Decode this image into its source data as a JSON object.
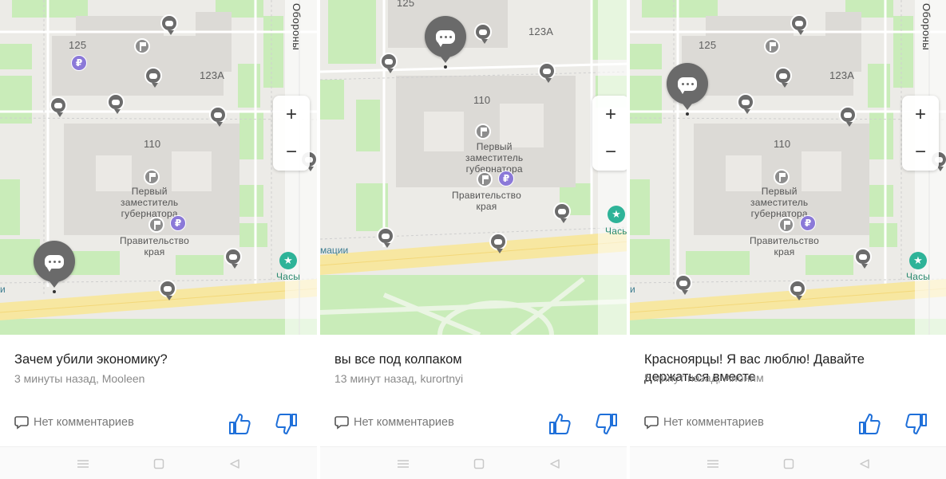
{
  "screens": [
    {
      "map": {
        "labels": {
          "house_125": "125",
          "house_123a": "123А",
          "house_110": "110",
          "street": "Обороны",
          "cut_label": "и"
        },
        "poi_deputy": "Первый\nзаместитель\nгубернатора",
        "poi_government": "Правительство\nкрая",
        "poi_clock": "Часы"
      },
      "post": {
        "title": "Зачем убили экономику?",
        "meta": "3 минуты назад, Mooleen"
      },
      "comments_label": "Нет комментариев"
    },
    {
      "map": {
        "labels": {
          "house_125": "125",
          "house_123a": "123А",
          "house_110": "110",
          "street": "",
          "cut_label": "мации"
        },
        "poi_deputy": "Первый\nзаместитель\nгубернатора",
        "poi_government": "Правительство\nкрая",
        "poi_clock": "Часы"
      },
      "post": {
        "title": "вы все под колпаком",
        "meta": "13 минут назад, kurortnyi"
      },
      "comments_label": "Нет комментариев"
    },
    {
      "map": {
        "labels": {
          "house_125": "125",
          "house_123a": "123А",
          "house_110": "110",
          "street": "Обороны",
          "cut_label": "и"
        },
        "poi_deputy": "Первый\nзаместитель\nгубернатора",
        "poi_government": "Правительство\nкрая",
        "poi_clock": "Часы"
      },
      "post": {
        "title": "Красноярцы! Я вас люблю! Давайте держаться вместе",
        "meta": "5 минут назад, Аноним"
      },
      "comments_label": "Нет комментариев"
    }
  ],
  "zoom": {
    "plus": "+",
    "minus": "−"
  },
  "icons": {
    "chat_pin": "comment-bubble-icon",
    "flag": "flag-icon",
    "ruble": "₽",
    "star": "★",
    "comments": "comment-icon",
    "like": "thumbs-up-icon",
    "dislike": "thumbs-down-icon",
    "nav_menu": "menu-icon",
    "nav_home": "home-square-icon",
    "nav_back": "back-triangle-icon"
  },
  "colors": {
    "accent_blue": "#1e6fd9",
    "pin_grey": "#6b6b6b",
    "ruble_purple": "#8b79d8",
    "star_green": "#2eb398",
    "road_yellow": "#f7e7a1",
    "park_green": "#c9ecb9"
  }
}
